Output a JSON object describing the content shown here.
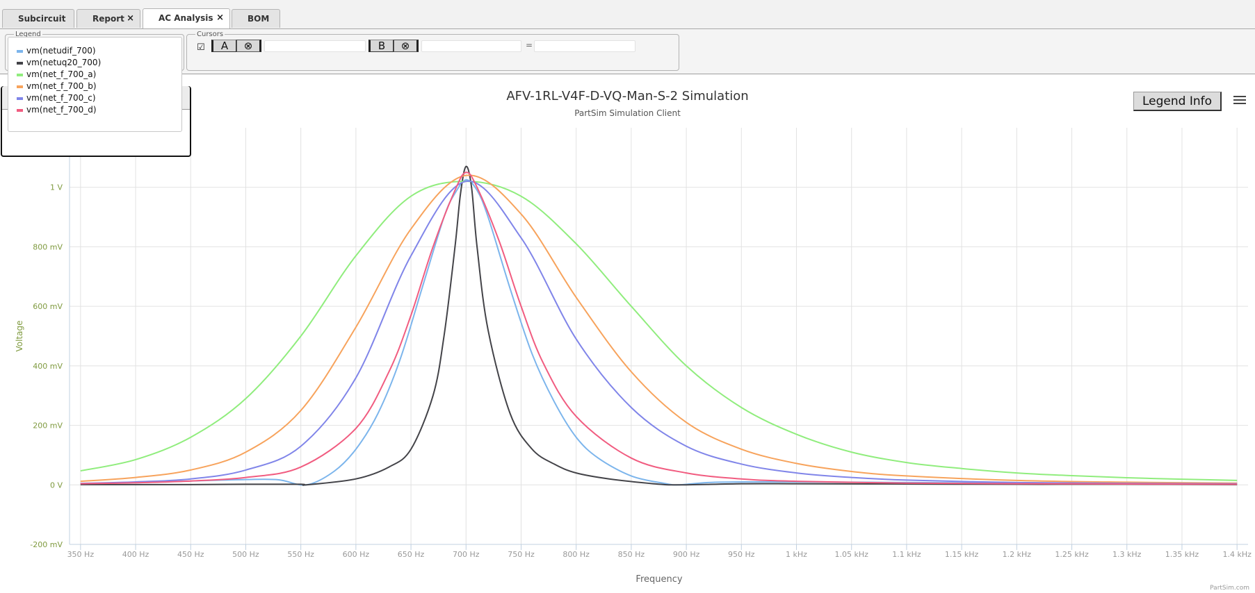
{
  "tabs": [
    {
      "label": "Subcircuit",
      "closable": false,
      "active": false
    },
    {
      "label": "Report",
      "closable": true,
      "active": false
    },
    {
      "label": "AC Analysis",
      "closable": true,
      "active": true
    },
    {
      "label": "BOM",
      "closable": false,
      "active": false
    }
  ],
  "tab_close_glyph": "×",
  "toolbar": {
    "legend_label": "Legend",
    "cursors_label": "Cursors",
    "cursor_checkbox": "☑",
    "cursor_a_label": "A",
    "cursor_b_label": "B",
    "cursor_clear_glyph": "⊗",
    "cursor_a_value": "",
    "cursor_b_value": "",
    "equals": "=",
    "diff_value": ""
  },
  "legend_info_label": "Legend Info",
  "credits": "PartSim.com",
  "icons": {
    "menu": "hamburger-menu-icon",
    "close": "close-icon",
    "clear": "clear-cursor-icon"
  },
  "chart_data": {
    "type": "line",
    "title": "AFV-1RL-V4F-D-VQ-Man-S-2 Simulation",
    "subtitle": "PartSim Simulation Client",
    "xlabel": "Frequency",
    "ylabel": "Voltage",
    "xlim": [
      340,
      1410
    ],
    "ylim": [
      -0.2,
      1.2
    ],
    "x_ticks": [
      {
        "value": 350,
        "label": "350 Hz"
      },
      {
        "value": 400,
        "label": "400 Hz"
      },
      {
        "value": 450,
        "label": "450 Hz"
      },
      {
        "value": 500,
        "label": "500 Hz"
      },
      {
        "value": 550,
        "label": "550 Hz"
      },
      {
        "value": 600,
        "label": "600 Hz"
      },
      {
        "value": 650,
        "label": "650 Hz"
      },
      {
        "value": 700,
        "label": "700 Hz"
      },
      {
        "value": 750,
        "label": "750 Hz"
      },
      {
        "value": 800,
        "label": "800 Hz"
      },
      {
        "value": 850,
        "label": "850 Hz"
      },
      {
        "value": 900,
        "label": "900 Hz"
      },
      {
        "value": 950,
        "label": "950 Hz"
      },
      {
        "value": 1000,
        "label": "1 kHz"
      },
      {
        "value": 1050,
        "label": "1.05 kHz"
      },
      {
        "value": 1100,
        "label": "1.1 kHz"
      },
      {
        "value": 1150,
        "label": "1.15 kHz"
      },
      {
        "value": 1200,
        "label": "1.2 kHz"
      },
      {
        "value": 1250,
        "label": "1.25 kHz"
      },
      {
        "value": 1300,
        "label": "1.3 kHz"
      },
      {
        "value": 1350,
        "label": "1.35 kHz"
      },
      {
        "value": 1400,
        "label": "1.4 kHz"
      }
    ],
    "y_ticks": [
      {
        "value": -0.2,
        "label": "-200 mV"
      },
      {
        "value": 0,
        "label": "0 V"
      },
      {
        "value": 0.2,
        "label": "200 mV"
      },
      {
        "value": 0.4,
        "label": "400 mV"
      },
      {
        "value": 0.6,
        "label": "600 mV"
      },
      {
        "value": 0.8,
        "label": "800 mV"
      },
      {
        "value": 1.0,
        "label": "1 V"
      }
    ],
    "grid": true,
    "legend_position": "top-left",
    "axis_label_color": "#7f9a3f",
    "series": [
      {
        "name": "vm(netudif_700)",
        "color": "#7cb5ec",
        "x": [
          350,
          400,
          450,
          500,
          530,
          555,
          580,
          600,
          620,
          640,
          660,
          680,
          690,
          700,
          710,
          720,
          740,
          760,
          780,
          800,
          820,
          850,
          880,
          893,
          920,
          960,
          1000,
          1100,
          1200,
          1300,
          1400
        ],
        "y": [
          0.003,
          0.008,
          0.013,
          0.018,
          0.017,
          0.0,
          0.045,
          0.12,
          0.24,
          0.42,
          0.66,
          0.9,
          0.98,
          1.025,
          0.99,
          0.9,
          0.66,
          0.44,
          0.28,
          0.16,
          0.09,
          0.03,
          0.005,
          0.0,
          0.008,
          0.01,
          0.01,
          0.008,
          0.006,
          0.005,
          0.004
        ]
      },
      {
        "name": "vm(netuq20_700)",
        "color": "#434348",
        "x": [
          350,
          450,
          500,
          550,
          555,
          600,
          630,
          650,
          670,
          680,
          690,
          695,
          700,
          705,
          710,
          720,
          740,
          760,
          780,
          800,
          830,
          870,
          893,
          950,
          1000,
          1100,
          1200,
          1300,
          1400
        ],
        "y": [
          0.001,
          0.001,
          0.002,
          0.002,
          0.0,
          0.02,
          0.06,
          0.12,
          0.3,
          0.5,
          0.8,
          0.98,
          1.07,
          1.0,
          0.8,
          0.52,
          0.24,
          0.12,
          0.07,
          0.04,
          0.02,
          0.004,
          0.0,
          0.004,
          0.004,
          0.003,
          0.002,
          0.002,
          0.001
        ]
      },
      {
        "name": "vm(net_f_700_a)",
        "color": "#90ed7d",
        "x": [
          350,
          400,
          450,
          500,
          550,
          600,
          650,
          700,
          750,
          800,
          850,
          900,
          950,
          1000,
          1050,
          1100,
          1150,
          1200,
          1250,
          1300,
          1350,
          1400
        ],
        "y": [
          0.047,
          0.085,
          0.16,
          0.29,
          0.5,
          0.77,
          0.97,
          1.02,
          0.97,
          0.81,
          0.6,
          0.4,
          0.26,
          0.17,
          0.11,
          0.075,
          0.055,
          0.04,
          0.031,
          0.024,
          0.019,
          0.015
        ]
      },
      {
        "name": "vm(net_f_700_b)",
        "color": "#f7a35c",
        "x": [
          350,
          400,
          450,
          500,
          550,
          600,
          650,
          700,
          750,
          800,
          850,
          900,
          950,
          1000,
          1050,
          1100,
          1200,
          1300,
          1400
        ],
        "y": [
          0.012,
          0.025,
          0.05,
          0.11,
          0.25,
          0.53,
          0.86,
          1.04,
          0.91,
          0.63,
          0.38,
          0.21,
          0.12,
          0.072,
          0.045,
          0.03,
          0.015,
          0.009,
          0.006
        ]
      },
      {
        "name": "vm(net_f_700_c)",
        "color": "#8085e9",
        "x": [
          350,
          400,
          450,
          500,
          550,
          600,
          650,
          700,
          750,
          800,
          850,
          900,
          950,
          1000,
          1050,
          1100,
          1200,
          1300,
          1400
        ],
        "y": [
          0.005,
          0.01,
          0.02,
          0.05,
          0.13,
          0.36,
          0.77,
          1.02,
          0.83,
          0.49,
          0.26,
          0.13,
          0.07,
          0.04,
          0.025,
          0.016,
          0.008,
          0.005,
          0.004
        ]
      },
      {
        "name": "vm(net_f_700_d)",
        "color": "#f15c80",
        "x": [
          350,
          400,
          450,
          500,
          550,
          600,
          630,
          650,
          670,
          690,
          700,
          710,
          730,
          750,
          770,
          800,
          850,
          900,
          950,
          1000,
          1100,
          1200,
          1300,
          1400
        ],
        "y": [
          0.004,
          0.007,
          0.013,
          0.025,
          0.06,
          0.19,
          0.38,
          0.57,
          0.8,
          0.99,
          1.05,
          1.0,
          0.82,
          0.6,
          0.41,
          0.23,
          0.09,
          0.04,
          0.02,
          0.012,
          0.006,
          0.004,
          0.003,
          0.002
        ]
      }
    ]
  }
}
